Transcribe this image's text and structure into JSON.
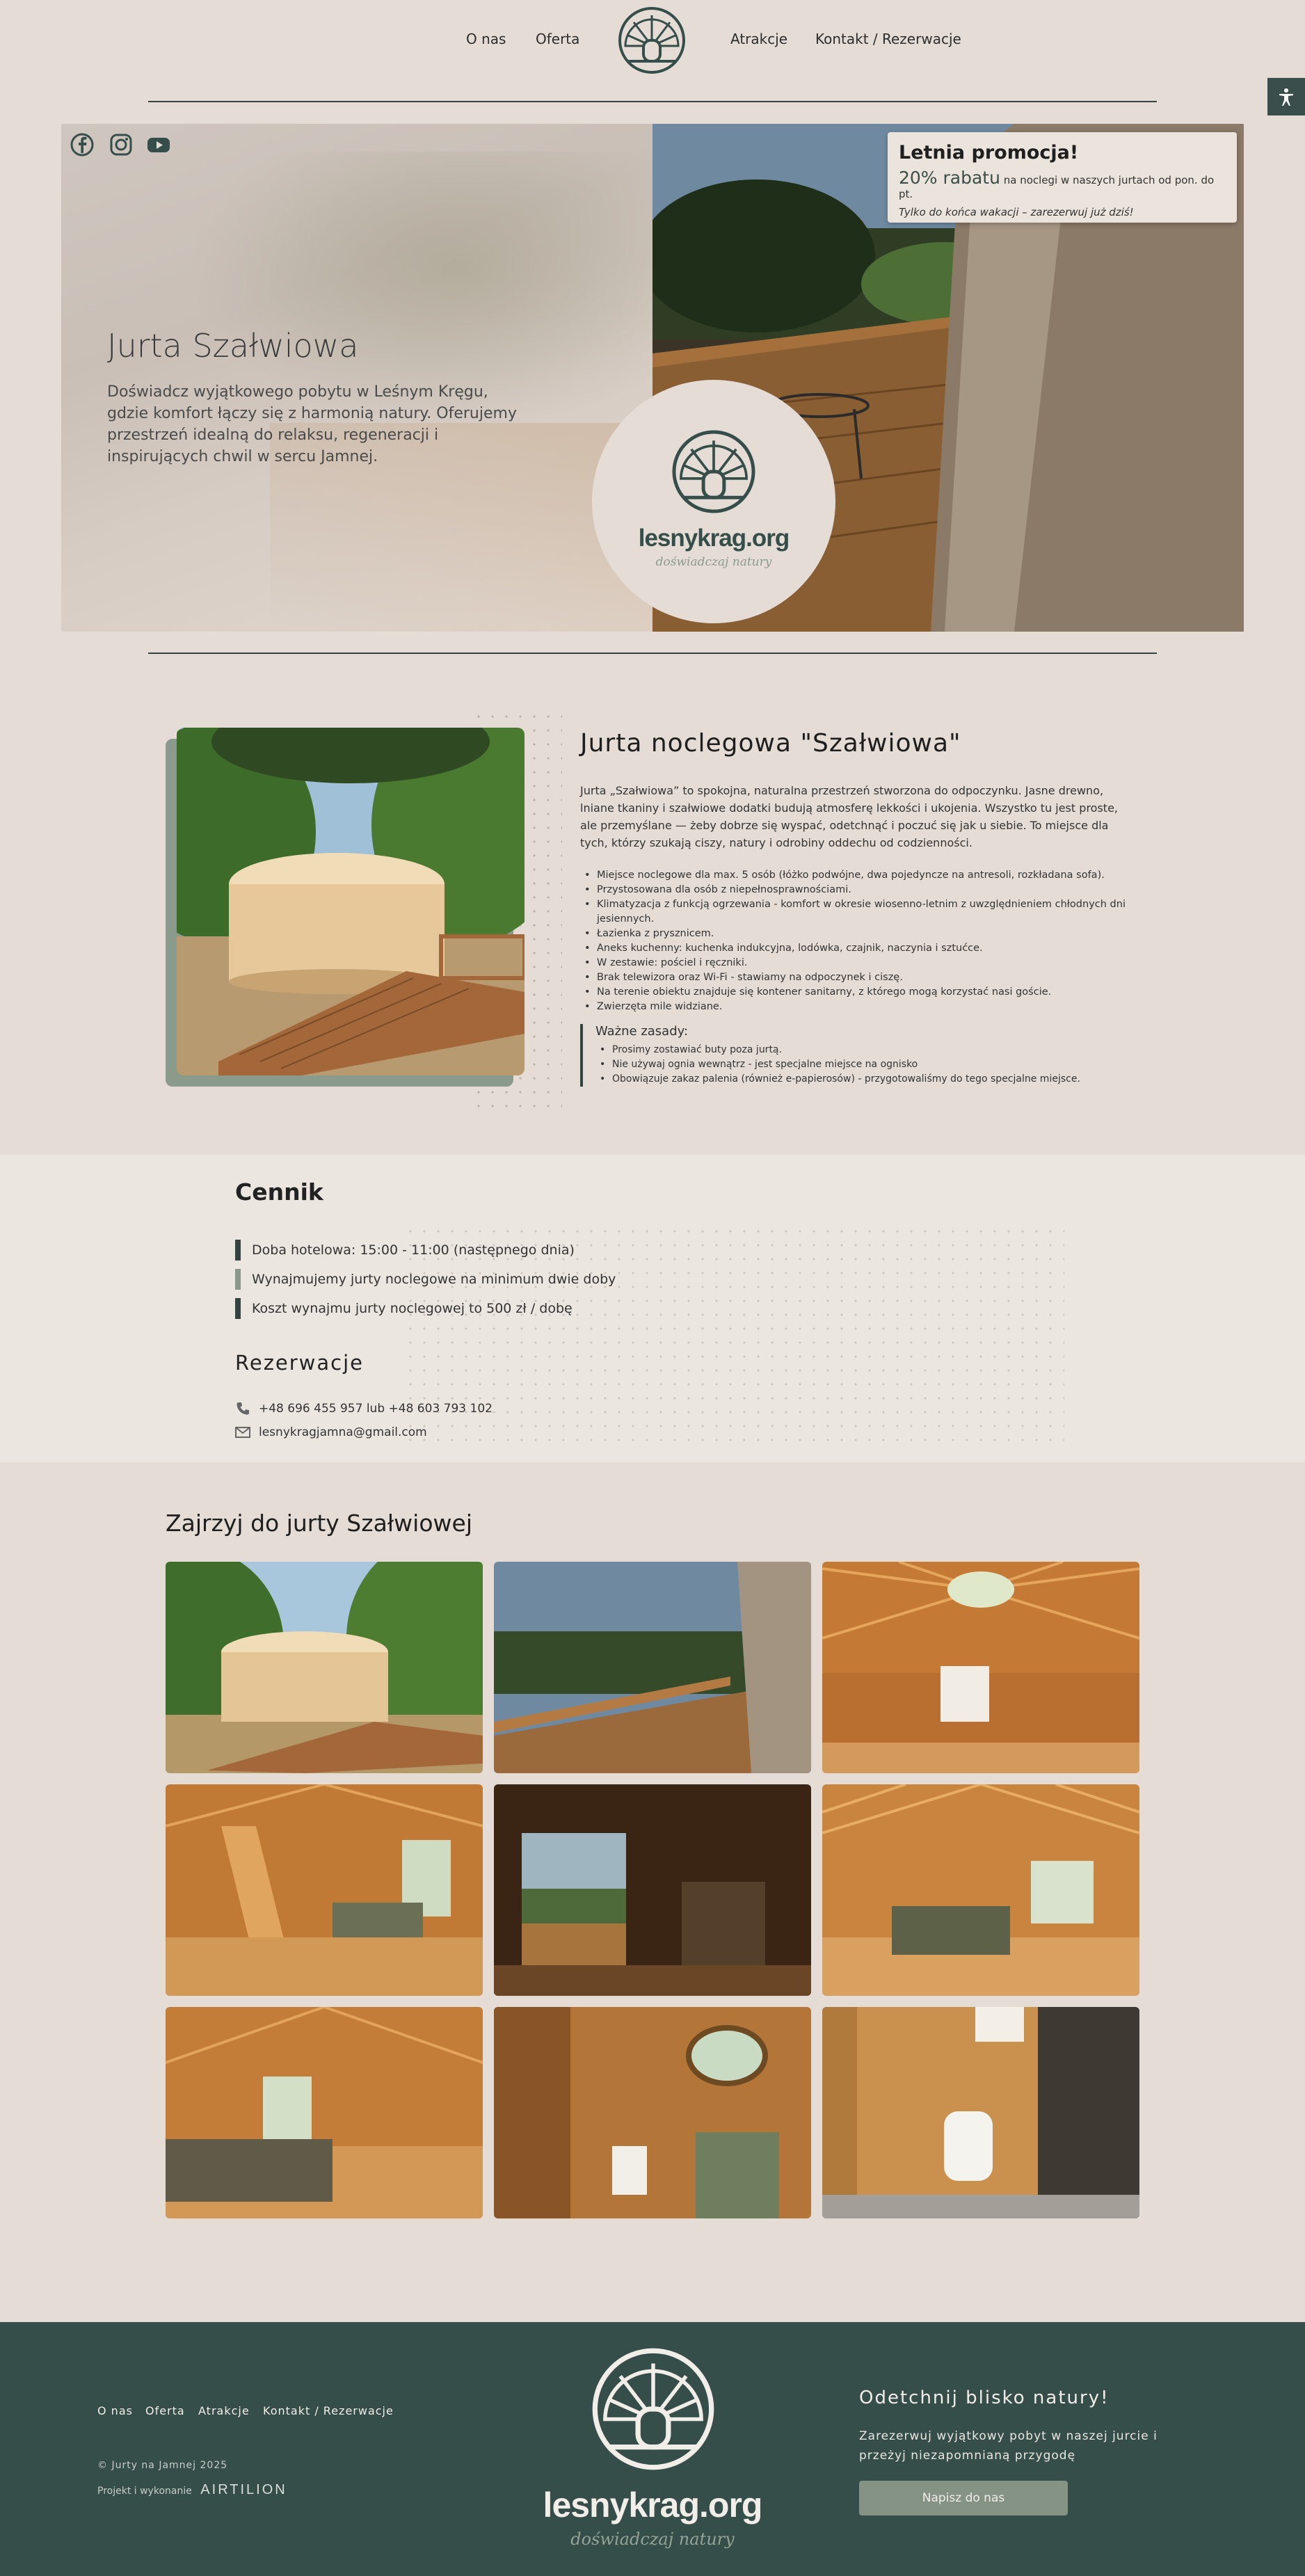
{
  "nav": {
    "items": [
      "O nas",
      "Oferta",
      "Atrakcje",
      "Kontakt / Rezerwacje"
    ]
  },
  "hero": {
    "title": "Jurta Szałwiowa",
    "description": "Doświadcz wyjątkowego pobytu w Leśnym Kręgu, gdzie komfort łączy się z harmonią natury. Oferujemy przestrzeń idealną do relaksu, regeneracji i inspirujących chwil w sercu Jamnej.",
    "brand": "lesnykrag.org",
    "tagline": "doświadczaj natury",
    "social": [
      "facebook-icon",
      "instagram-icon",
      "youtube-icon"
    ]
  },
  "promo": {
    "title": "Letnia promocja!",
    "discount": "20% rabatu",
    "detail": "na noclegi w naszych jurtach od pon. do pt.",
    "note": "Tylko do końca wakacji – zarezerwuj już dziś!"
  },
  "about": {
    "title": "Jurta noclegowa \"Szałwiowa\"",
    "text": "Jurta „Szałwiowa” to spokojna, naturalna przestrzeń stworzona do odpoczynku. Jasne drewno, lniane tkaniny i szałwiowe dodatki budują atmosferę lekkości i ukojenia. Wszystko tu jest proste, ale przemyślane — żeby dobrze się wyspać, odetchnąć i poczuć się jak u siebie. To miejsce dla tych, którzy szukają ciszy, natury i odrobiny oddechu od codzienności.",
    "features": [
      "Miejsce noclegowe dla max. 5 osób (łóżko podwójne, dwa pojedyncze na antresoli, rozkładana sofa).",
      "Przystosowana dla osób z niepełnosprawnościami.",
      "Klimatyzacja z funkcją ogrzewania - komfort w okresie wiosenno-letnim z uwzględnieniem chłodnych dni jesiennych.",
      "Łazienka z prysznicem.",
      "Aneks kuchenny: kuchenka indukcyjna, lodówka, czajnik, naczynia i sztućce.",
      "W zestawie: pościel i ręczniki.",
      "Brak telewizora oraz Wi-Fi - stawiamy na odpoczynek i ciszę.",
      "Na terenie obiektu znajduje się kontener sanitarny, z którego mogą korzystać nasi goście.",
      "Zwierzęta mile widziane."
    ],
    "rules_title": "Ważne zasady:",
    "rules": [
      "Prosimy zostawiać buty poza jurtą.",
      "Nie używaj ognia wewnątrz - jest specjalne miejsce na ognisko",
      "Obowiązuje zakaz palenia (również e-papierosów) - przygotowaliśmy do tego specjalne miejsce."
    ]
  },
  "pricing": {
    "title": "Cennik",
    "items": [
      "Doba hotelowa: 15:00 - 11:00 (następnego dnia)",
      "Wynajmujemy jurty noclegowe na minimum dwie doby",
      "Koszt wynajmu jurty noclegowej to 500 zł / dobę"
    ],
    "reservation_title": "Rezerwacje",
    "phone": "+48 696 455 957 lub +48 603 793 102",
    "email": "lesnykragjamna@gmail.com"
  },
  "gallery": {
    "title": "Zajrzyj do jurty Szałwiowej"
  },
  "footer": {
    "nav": [
      "O nas",
      "Oferta",
      "Atrakcje",
      "Kontakt / Rezerwacje"
    ],
    "copyright": "© Jurty na Jamnej 2025",
    "made_by": "Projekt i wykonanie",
    "made_by_brand": "AIRTILION",
    "brand": "lesnykrag.org",
    "tagline": "doświadczaj natury",
    "cta_title": "Odetchnij blisko natury!",
    "cta_text": "Zarezerwuj wyjątkowy pobyt w naszej jurcie i przeżyj niezapomnianą przygodę",
    "cta_button": "Napisz do nas"
  },
  "colors": {
    "background": "#e5dcd5",
    "accent": "#364e4a",
    "sage": "#849383"
  }
}
